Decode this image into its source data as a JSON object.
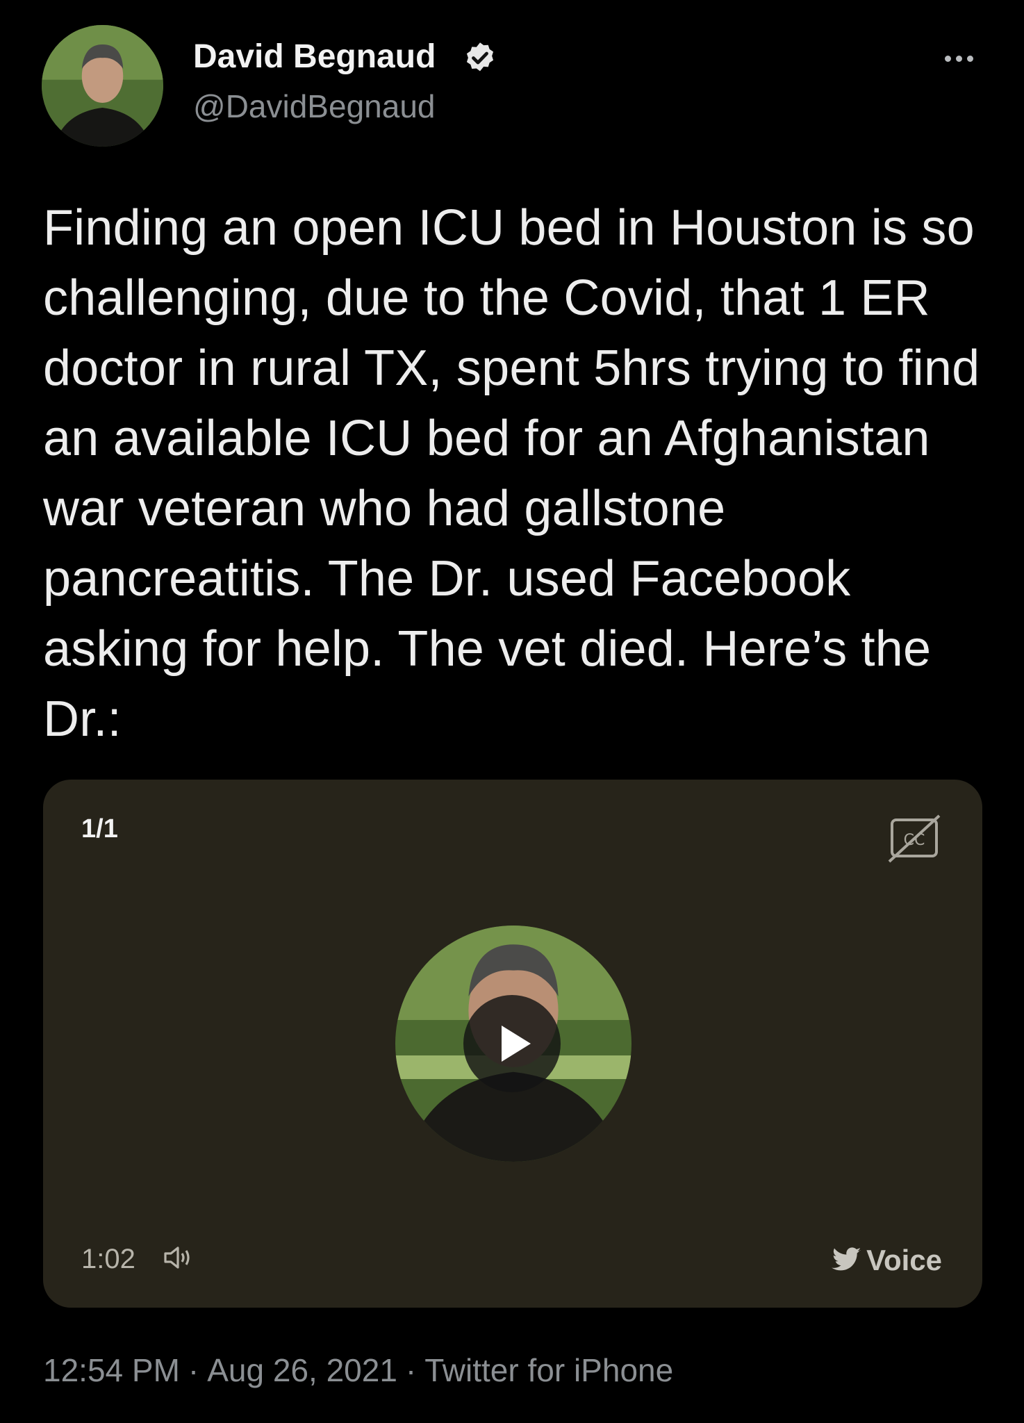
{
  "tweet": {
    "author": {
      "name": "David Begnaud",
      "handle": "@DavidBegnaud",
      "verified": true
    },
    "text": "Finding an open ICU bed in Houston is so challenging, due to the Covid, that 1 ER doctor in rural TX, spent 5hrs trying to find an available ICU bed for an Afghanistan war veteran who had gallstone pancreatitis. The Dr. used Facebook asking for help. The vet died. Here’s the Dr.:",
    "media": {
      "counter": "1/1",
      "duration": "1:02",
      "badge": "Voice",
      "icons": [
        "cc-icon",
        "play-icon",
        "volume-icon",
        "twitter-bird-icon"
      ]
    },
    "meta": {
      "time": "12:54 PM",
      "separator": "·",
      "date": "Aug 26, 2021",
      "source": "Twitter for iPhone"
    }
  },
  "colors": {
    "background": "#000000",
    "text": "#e7e9ea",
    "secondary_text": "#8b8f93",
    "media_card": "#27241a"
  }
}
